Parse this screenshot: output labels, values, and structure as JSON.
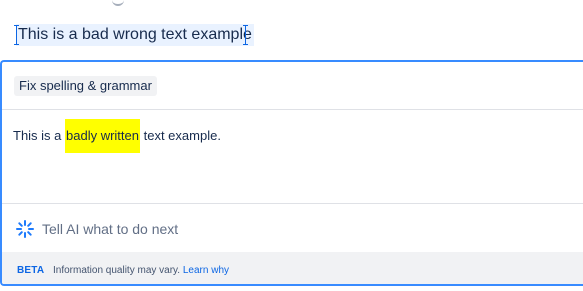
{
  "editor": {
    "selected_text": "This is a bad wrong text example"
  },
  "ai_panel": {
    "action_label": "Fix spelling & grammar",
    "result": {
      "before": "This is a ",
      "highlight": "badly written",
      "after": " text example."
    },
    "prompt_placeholder": "Tell AI what to do next",
    "footer": {
      "beta_label": "BETA",
      "note": "Information quality may vary.",
      "learn_link": "Learn why"
    }
  },
  "colors": {
    "accent": "#0c66e4",
    "panel_border": "#388bff",
    "highlight": "#ffff00",
    "footer_bg": "#f1f2f4"
  },
  "icons": {
    "prompt": "sparkle-icon"
  }
}
